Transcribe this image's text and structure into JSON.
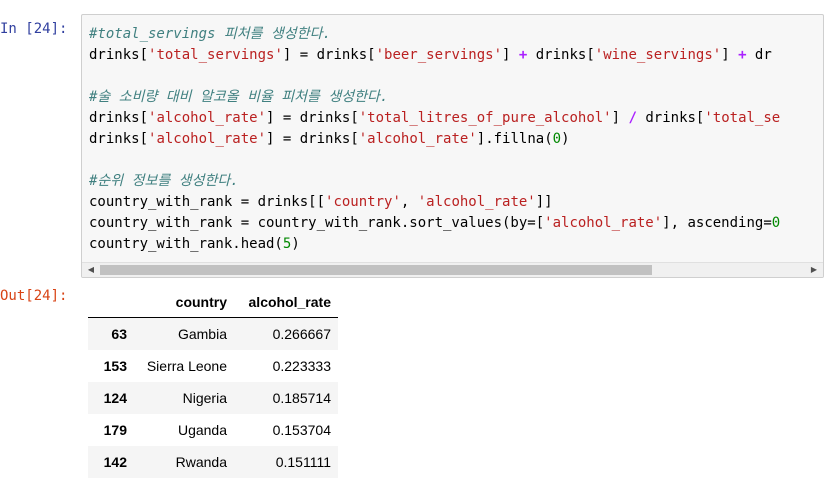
{
  "input_prompt": "In [24]:",
  "output_prompt": "Out[24]:",
  "code_lines": [
    [
      {
        "t": "cm",
        "v": "#total_servings 피처를 생성한다."
      }
    ],
    [
      {
        "t": "",
        "v": "drinks["
      },
      {
        "t": "st",
        "v": "'total_servings'"
      },
      {
        "t": "",
        "v": "] = drinks["
      },
      {
        "t": "st",
        "v": "'beer_servings'"
      },
      {
        "t": "",
        "v": "] "
      },
      {
        "t": "op",
        "v": "+"
      },
      {
        "t": "",
        "v": " drinks["
      },
      {
        "t": "st",
        "v": "'wine_servings'"
      },
      {
        "t": "",
        "v": "] "
      },
      {
        "t": "op",
        "v": "+"
      },
      {
        "t": "",
        "v": " dr"
      }
    ],
    [],
    [
      {
        "t": "cm",
        "v": "#술 소비량 대비 알코올 비율 피처를 생성한다."
      }
    ],
    [
      {
        "t": "",
        "v": "drinks["
      },
      {
        "t": "st",
        "v": "'alcohol_rate'"
      },
      {
        "t": "",
        "v": "] = drinks["
      },
      {
        "t": "st",
        "v": "'total_litres_of_pure_alcohol'"
      },
      {
        "t": "",
        "v": "] "
      },
      {
        "t": "op",
        "v": "/"
      },
      {
        "t": "",
        "v": " drinks["
      },
      {
        "t": "st",
        "v": "'total_se"
      }
    ],
    [
      {
        "t": "",
        "v": "drinks["
      },
      {
        "t": "st",
        "v": "'alcohol_rate'"
      },
      {
        "t": "",
        "v": "] = drinks["
      },
      {
        "t": "st",
        "v": "'alcohol_rate'"
      },
      {
        "t": "",
        "v": "].fillna("
      },
      {
        "t": "nm",
        "v": "0"
      },
      {
        "t": "",
        "v": ")"
      }
    ],
    [],
    [
      {
        "t": "cm",
        "v": "#순위 정보를 생성한다."
      }
    ],
    [
      {
        "t": "",
        "v": "country_with_rank = drinks[["
      },
      {
        "t": "st",
        "v": "'country'"
      },
      {
        "t": "",
        "v": ", "
      },
      {
        "t": "st",
        "v": "'alcohol_rate'"
      },
      {
        "t": "",
        "v": "]]"
      }
    ],
    [
      {
        "t": "",
        "v": "country_with_rank = country_with_rank.sort_values(by=["
      },
      {
        "t": "st",
        "v": "'alcohol_rate'"
      },
      {
        "t": "",
        "v": "], ascending="
      },
      {
        "t": "nm",
        "v": "0"
      }
    ],
    [
      {
        "t": "",
        "v": "country_with_rank.head("
      },
      {
        "t": "nm",
        "v": "5"
      },
      {
        "t": "",
        "v": ")"
      }
    ]
  ],
  "table": {
    "columns": [
      "",
      "country",
      "alcohol_rate"
    ],
    "rows": [
      {
        "index": "63",
        "country": "Gambia",
        "alcohol_rate": "0.266667"
      },
      {
        "index": "153",
        "country": "Sierra Leone",
        "alcohol_rate": "0.223333"
      },
      {
        "index": "124",
        "country": "Nigeria",
        "alcohol_rate": "0.185714"
      },
      {
        "index": "179",
        "country": "Uganda",
        "alcohol_rate": "0.153704"
      },
      {
        "index": "142",
        "country": "Rwanda",
        "alcohol_rate": "0.151111"
      }
    ]
  },
  "scrollbar": {
    "left_arrow": "◀",
    "right_arrow": "▶"
  }
}
